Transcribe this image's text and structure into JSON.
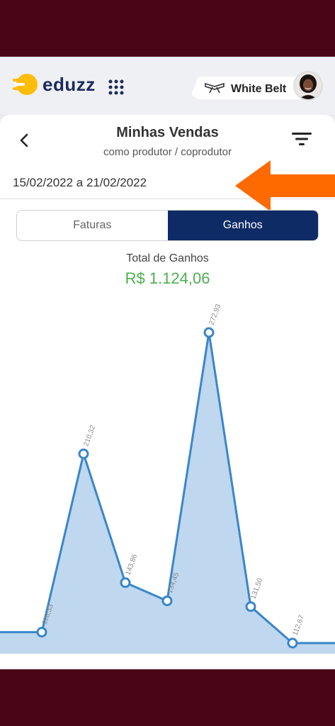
{
  "header": {
    "brand": "eduzz",
    "belt_label": "White Belt",
    "icons": {
      "logo": "eduzz-logo-icon",
      "apps": "apps-grid-icon",
      "belt": "belt-icon",
      "avatar": "user-avatar"
    }
  },
  "page": {
    "title": "Minhas Vendas",
    "subtitle": "como produtor / coprodutor",
    "date_range": "15/02/2022 a 21/02/2022",
    "icons": {
      "back": "back-chevron-icon",
      "filter": "filter-icon",
      "arrow": "orange-arrow-icon"
    }
  },
  "tabs": [
    {
      "label": "Faturas",
      "active": false
    },
    {
      "label": "Ganhos",
      "active": true
    }
  ],
  "summary": {
    "label": "Total de Ganhos",
    "value": "R$  1.124,06"
  },
  "colors": {
    "brand_navy": "#0f2b66",
    "accent_orange": "#ff6a00",
    "total_green": "#4caf50",
    "line_blue": "#3a86c8",
    "area_blue": "#a9c9ea",
    "frame": "#4a0617"
  },
  "chart_data": {
    "type": "area",
    "series": [
      {
        "values": [
          118.33,
          210.32,
          143.86,
          134.45,
          272.93,
          131.5,
          112.67
        ]
      }
    ],
    "labels": [
      "118,33",
      "210,32",
      "143,86",
      "134,45",
      "272,93",
      "131,50",
      "112,67"
    ],
    "ylim": [
      75,
      300
    ],
    "grid": false,
    "legend": "none"
  }
}
